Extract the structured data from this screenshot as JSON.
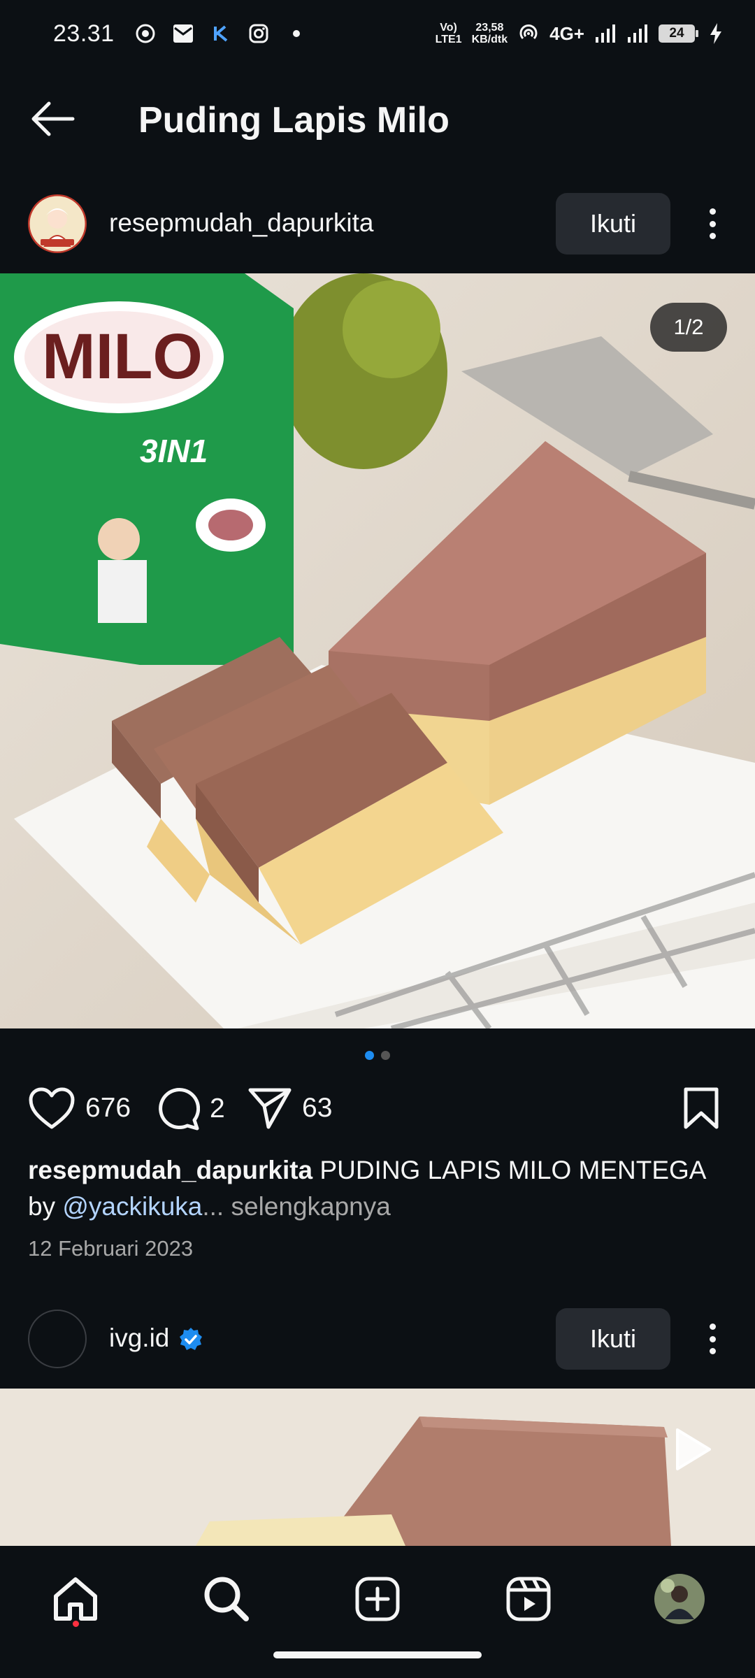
{
  "status_bar": {
    "time": "23.31",
    "volte": "Vo)\nLTE1",
    "speed": "23,58\nKB/dtk",
    "network": "4G+",
    "battery": "24"
  },
  "header": {
    "title": "Puding Lapis Milo"
  },
  "post": {
    "username": "resepmudah_dapurkita",
    "follow_label": "Ikuti",
    "media_counter": "1/2",
    "likes": "676",
    "comments": "2",
    "shares": "63",
    "caption_user": "resepmudah_dapurkita",
    "caption_text": " PUDING LAPIS MILO MENTEGA",
    "caption_by": "by ",
    "caption_mention": "@yackikuka",
    "caption_ellipsis": "...",
    "caption_more": " selengkapnya",
    "date": "12 Februari 2023"
  },
  "next_post": {
    "username": "ivg.id",
    "follow_label": "Ikuti"
  },
  "icons": {
    "back": "arrow-left-icon",
    "like": "heart-icon",
    "comment": "comment-icon",
    "share": "paper-plane-icon",
    "save": "bookmark-icon",
    "more": "more-vertical-icon",
    "verified": "verified-badge-icon",
    "play": "play-icon",
    "home": "home-icon",
    "search": "search-icon",
    "create": "plus-square-icon",
    "reels": "reels-icon",
    "profile": "profile-avatar"
  },
  "colors": {
    "background": "#0c1014",
    "accent_blue": "#1d8cf0",
    "mention": "#b3d4ff",
    "notification": "#ff3040"
  }
}
